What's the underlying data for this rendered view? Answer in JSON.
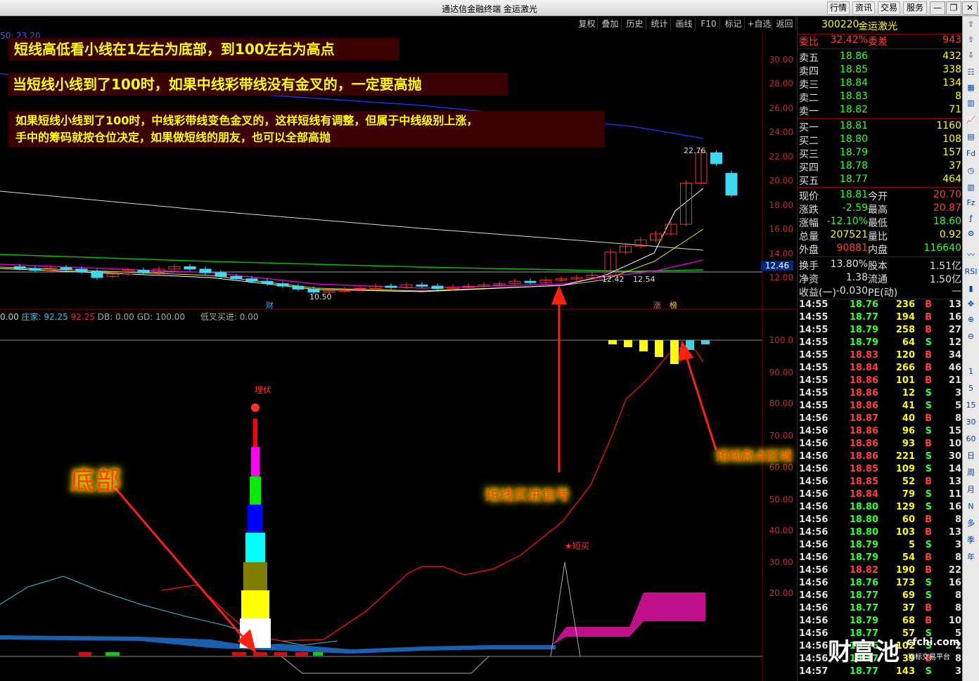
{
  "window": {
    "title": "通达信金融终端  金运激光",
    "top_buttons": [
      "行情",
      "资讯",
      "交易",
      "服务"
    ],
    "win_controls": [
      "—",
      "❐",
      "✕"
    ]
  },
  "toolbar": {
    "items": [
      "复权",
      "叠加",
      "历史",
      "统计",
      "画线",
      "F10",
      "标记",
      "+自选",
      "返回"
    ]
  },
  "main": {
    "annotations": [
      "短线高低看小线在1左右为底部，到100左右为高点",
      "当短线小线到了100时，如果中线彩带线没有金叉的，一定要高抛",
      "如果短线小线到了100时，中线彩带线变色金叉的，这样短线有调整，但属于中线级别上涨，",
      "手中的筹码就按仓位决定，如果做短线的朋友，也可以全部高抛"
    ],
    "top_left_label": "50: 23.20",
    "price_axis": [
      "30.00",
      "28.00",
      "26.00",
      "24.00",
      "22.00",
      "20.00",
      "18.00",
      "16.00",
      "14.00",
      "12.00"
    ],
    "last_price_tag": "12.46",
    "marks": {
      "high": "22.76",
      "low": "10.50",
      "low2a": "12.42",
      "low2b": "12.54",
      "cai": "财",
      "zhang": "涨",
      "bang": "榜"
    },
    "indicator_header": {
      "p1": "0.00",
      "zj_label": "庄家:",
      "zj_val": "92.25",
      "v2": "92.25",
      "db": "DB: 0.00",
      "gd": "GD: 100.00",
      "dc": "低叉买进: 0.00"
    },
    "ind_axis": [
      "100.0",
      "90.00",
      "80.00",
      "70.00",
      "60.00",
      "50.00",
      "40.00",
      "30.00",
      "20.00"
    ],
    "labels": {
      "maifu": "埋伏",
      "duanmai": "★短买",
      "dibu": "底部",
      "buy": "短线买进信号",
      "high": "短线高点区域"
    }
  },
  "chart_data": {
    "type": "line",
    "ylim": [
      10,
      31
    ],
    "candles": [
      [
        1,
        12.9,
        12.75
      ],
      [
        2,
        12.75,
        12.6
      ],
      [
        3,
        12.6,
        12.8
      ],
      [
        4,
        12.82,
        12.7
      ],
      [
        5,
        12.7,
        12.5
      ],
      [
        6,
        12.5,
        12.0
      ],
      [
        7,
        12.1,
        12.3
      ],
      [
        8,
        12.3,
        12.6
      ],
      [
        9,
        12.6,
        12.4
      ],
      [
        10,
        12.4,
        12.7
      ],
      [
        11,
        12.7,
        12.9
      ],
      [
        12,
        12.9,
        12.7
      ],
      [
        13,
        12.7,
        12.4
      ],
      [
        14,
        12.4,
        12.1
      ],
      [
        15,
        12.1,
        11.9
      ],
      [
        16,
        11.9,
        11.7
      ],
      [
        17,
        11.7,
        11.5
      ],
      [
        18,
        11.5,
        11.3
      ],
      [
        19,
        11.3,
        11.05
      ],
      [
        20,
        11.05,
        10.8
      ],
      [
        21,
        10.8,
        10.9
      ],
      [
        22,
        10.9,
        11.0
      ],
      [
        23,
        11.0,
        11.1
      ],
      [
        24,
        11.1,
        11.3
      ],
      [
        25,
        11.3,
        11.2
      ],
      [
        26,
        11.2,
        11.4
      ],
      [
        27,
        11.4,
        11.3
      ],
      [
        28,
        11.3,
        11.1
      ],
      [
        29,
        11.1,
        11.2
      ],
      [
        30,
        11.2,
        11.3
      ],
      [
        31,
        11.3,
        11.4
      ],
      [
        32,
        11.4,
        11.5
      ],
      [
        33,
        11.5,
        11.7
      ],
      [
        34,
        11.7,
        11.6
      ],
      [
        35,
        11.6,
        11.8
      ],
      [
        36,
        11.8,
        11.9
      ],
      [
        37,
        11.9,
        12.0
      ],
      [
        38,
        12.0,
        12.2
      ],
      [
        39,
        12.2,
        14.1
      ],
      [
        40,
        14.1,
        14.6
      ],
      [
        41,
        14.6,
        15.1
      ],
      [
        42,
        15.1,
        15.6
      ],
      [
        43,
        15.6,
        16.4
      ],
      [
        44,
        16.4,
        19.8
      ],
      [
        45,
        19.8,
        22.3
      ],
      [
        46,
        22.3,
        21.4
      ],
      [
        47,
        20.6,
        18.8
      ]
    ]
  }
}
